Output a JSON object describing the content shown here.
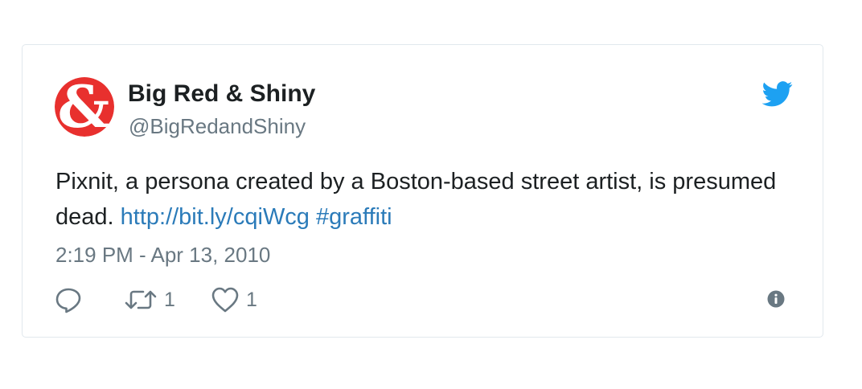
{
  "tweet": {
    "author_name": "Big Red & Shiny",
    "author_handle": "@BigRedandShiny",
    "text_before_link": "Pixnit, a persona created by a Boston-based street artist, is presumed dead. ",
    "link": "http://bit.ly/cqiWcg",
    "hashtag": "#graffiti",
    "timestamp": "2:19 PM - Apr 13, 2010"
  },
  "actions": {
    "reply_icon": "reply-icon",
    "retweet_icon": "retweet-icon",
    "retweet_count": "1",
    "like_icon": "heart-icon",
    "like_count": "1",
    "info_icon": "info-icon"
  },
  "colors": {
    "brand_red": "#e8302e",
    "twitter_blue": "#1da1f2",
    "link_blue": "#2b7bb9",
    "muted_gray": "#697882",
    "text_dark": "#1c2022",
    "border": "#e1e8ed"
  }
}
